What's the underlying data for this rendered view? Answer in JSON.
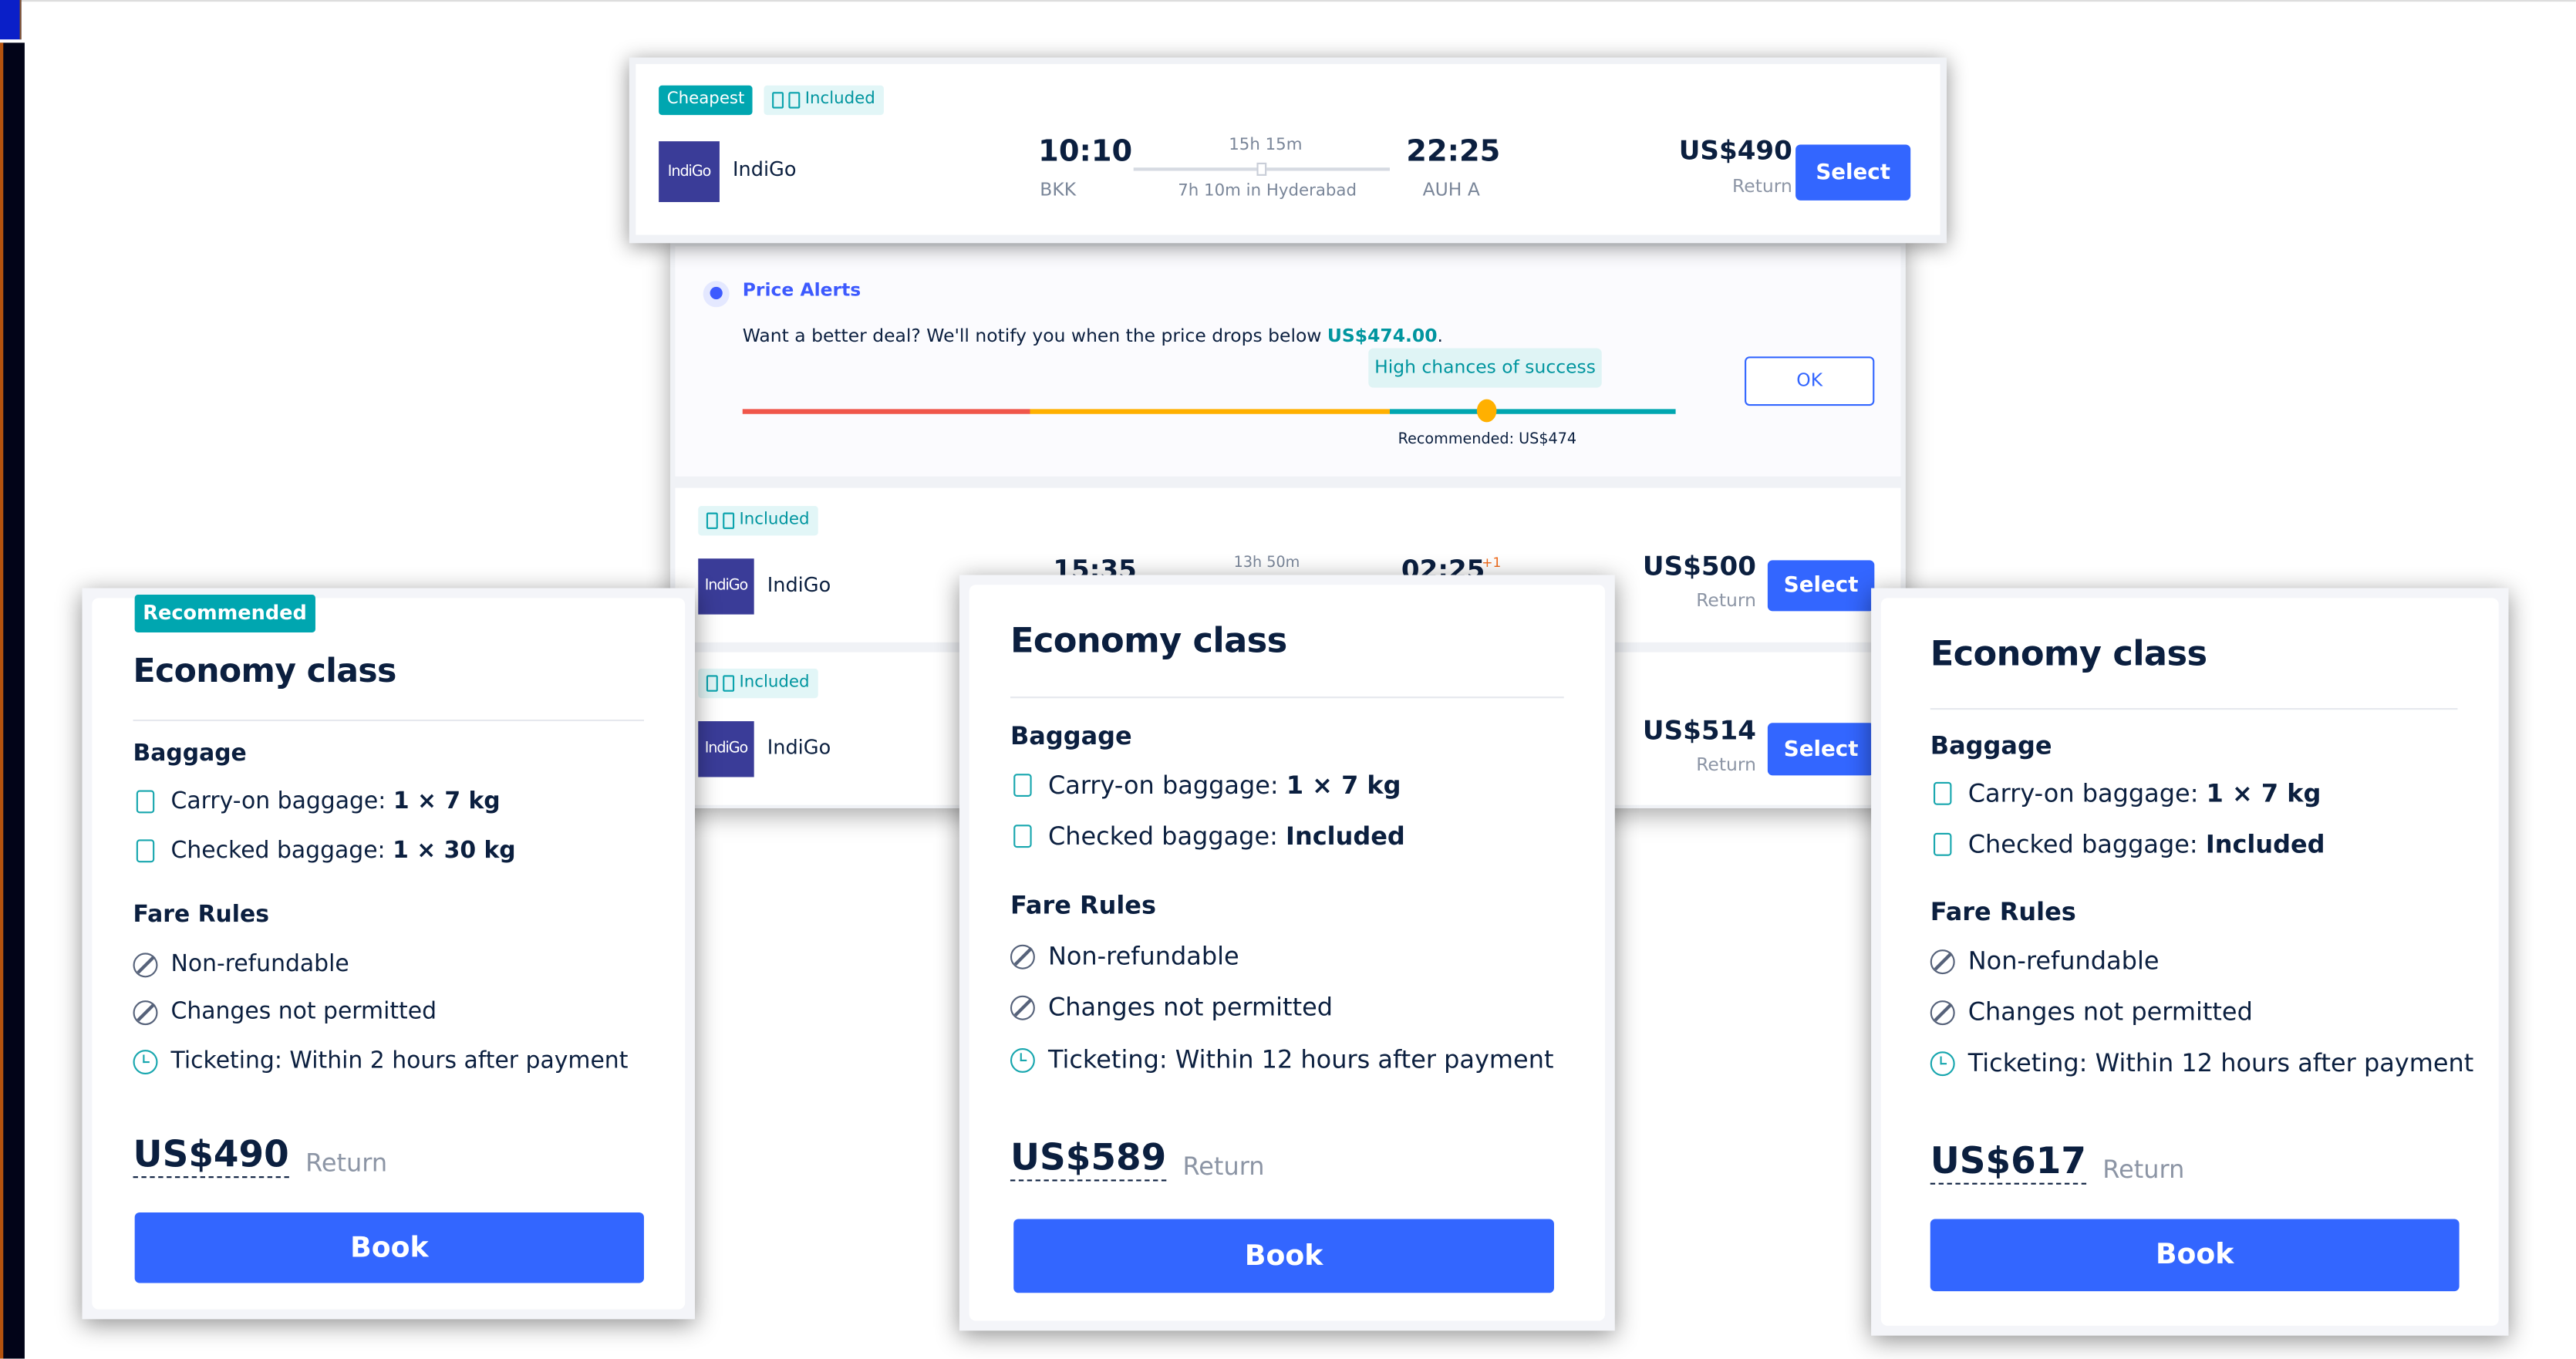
{
  "colors": {
    "accent": "#3366ff",
    "teal": "#00a6b0",
    "navy": "#0b1f3f",
    "airline_logo": "#3a3c98"
  },
  "top_flight": {
    "badge_cheapest": "Cheapest",
    "badge_included": "Included",
    "logo": "IndiGo",
    "airline": "IndiGo",
    "depart_time": "10:10",
    "depart_airport": "BKK",
    "duration": "15h 15m",
    "stopover": "7h 10m in Hyderabad",
    "arrive_time": "22:25",
    "arrive_airport": "AUH A",
    "price": "US$490",
    "price_type": "Return",
    "select": "Select"
  },
  "price_alert": {
    "title": "Price Alerts",
    "text": "Want a better deal? We'll notify you when the price drops below ",
    "target": "US$474.00",
    "text_end": ".",
    "bubble": "High chances of success",
    "recommended": "Recommended: US$474",
    "ok": "OK"
  },
  "flights": [
    {
      "badge": "Included",
      "logo": "IndiGo",
      "airline": "IndiGo",
      "depart_time": "15:35",
      "duration": "13h 50m",
      "arrive_time": "02:25",
      "day_offset": "+1",
      "price": "US$500",
      "price_type": "Return",
      "select": "Select"
    },
    {
      "badge": "Included",
      "logo": "IndiGo",
      "airline": "IndiGo",
      "price": "US$514",
      "price_type": "Return",
      "select": "Select"
    }
  ],
  "fare_cards": [
    {
      "badge": "Recommended",
      "title": "Economy class",
      "baggage_heading": "Baggage",
      "carry_label": "Carry-on baggage: ",
      "carry_value": "1 × 7 kg",
      "checked_label": "Checked baggage: ",
      "checked_value": "1 × 30 kg",
      "rules_heading": "Fare Rules",
      "rule1": "Non-refundable",
      "rule2": "Changes not permitted",
      "rule3": "Ticketing: Within 2 hours after payment",
      "price": "US$490",
      "price_type": "Return",
      "book": "Book"
    },
    {
      "title": "Economy class",
      "baggage_heading": "Baggage",
      "carry_label": "Carry-on baggage: ",
      "carry_value": "1 × 7 kg",
      "checked_label": "Checked baggage: ",
      "checked_value": "Included",
      "rules_heading": "Fare Rules",
      "rule1": "Non-refundable",
      "rule2": "Changes not permitted",
      "rule3": "Ticketing: Within 12 hours after payment",
      "price": "US$589",
      "price_type": "Return",
      "book": "Book"
    },
    {
      "title": "Economy class",
      "baggage_heading": "Baggage",
      "carry_label": "Carry-on baggage: ",
      "carry_value": "1 × 7 kg",
      "checked_label": "Checked baggage: ",
      "checked_value": "Included",
      "rules_heading": "Fare Rules",
      "rule1": "Non-refundable",
      "rule2": "Changes not permitted",
      "rule3": "Ticketing: Within 12 hours after payment",
      "price": "US$617",
      "price_type": "Return",
      "book": "Book"
    }
  ]
}
